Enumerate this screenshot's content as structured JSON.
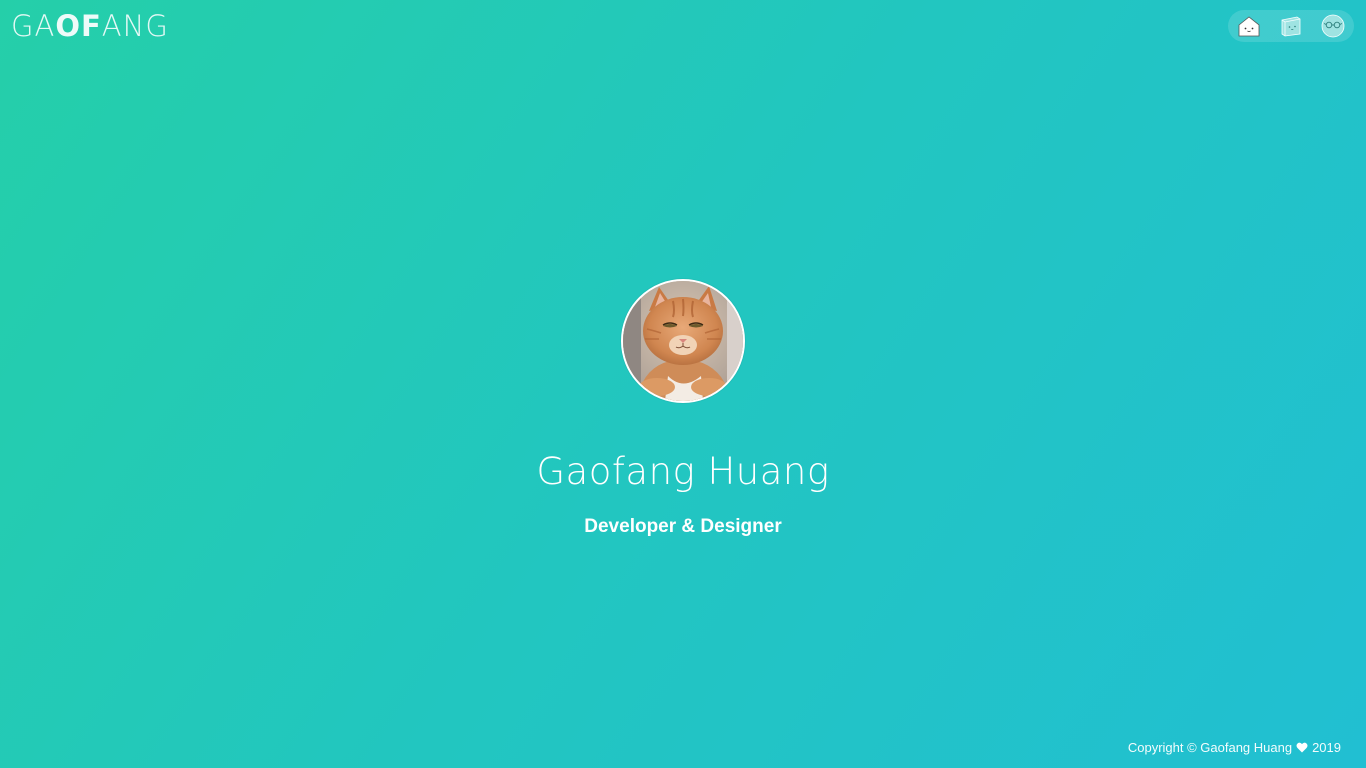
{
  "header": {
    "logo": {
      "part1": "GA",
      "part2": "OF",
      "part3": "ANG"
    },
    "nav": [
      {
        "icon": "home-face-icon"
      },
      {
        "icon": "box-face-icon"
      },
      {
        "icon": "glasses-face-icon"
      }
    ]
  },
  "profile": {
    "avatar_alt": "cat-avatar",
    "name": "Gaofang Huang",
    "role": "Developer & Designer"
  },
  "footer": {
    "copyright_prefix": "Copyright © Gaofang Huang",
    "year": "2019"
  },
  "colors": {
    "gradient_start": "#25cfa9",
    "gradient_end": "#21bfd2",
    "text": "#ffffff"
  }
}
